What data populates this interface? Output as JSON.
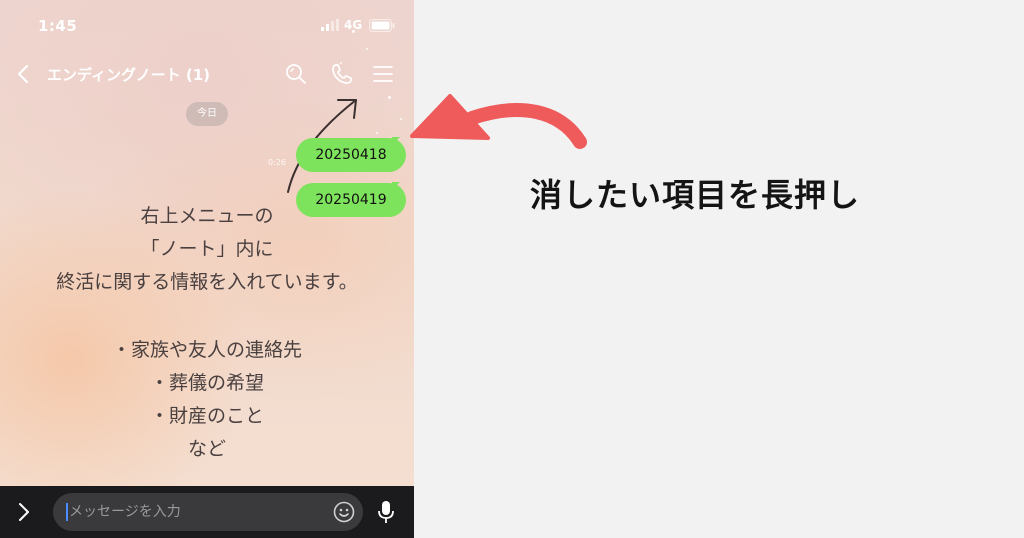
{
  "status_bar": {
    "time": "1:45",
    "network": "4G",
    "icons": [
      "signal-icon",
      "battery-icon"
    ]
  },
  "chat": {
    "title": "エンディングノート (1)",
    "header_icons": [
      "back-icon",
      "search-icon",
      "phone-call-icon",
      "menu-icon"
    ],
    "date_label": "今日",
    "messages": [
      {
        "text": "20250418",
        "time": "0:26"
      },
      {
        "text": "20250419",
        "time": ""
      }
    ]
  },
  "background_text": {
    "lines": [
      "右上メニューの",
      "「ノート」内に",
      "終活に関する情報を入れています。"
    ],
    "list": [
      "・家族や友人の連絡先",
      "・葬儀の希望",
      "・財産のこと",
      "など"
    ]
  },
  "input_bar": {
    "placeholder": "メッセージを入力",
    "icons": [
      "expand-icon",
      "emoji-icon",
      "mic-icon"
    ]
  },
  "annotation": {
    "instruction": "消したい項目を長押し",
    "arrow_color": "#ef5a5a"
  },
  "colors": {
    "bubble": "#7ee35c",
    "input_bar": "#1b1b1d",
    "canvas": "#f2f2f2"
  }
}
